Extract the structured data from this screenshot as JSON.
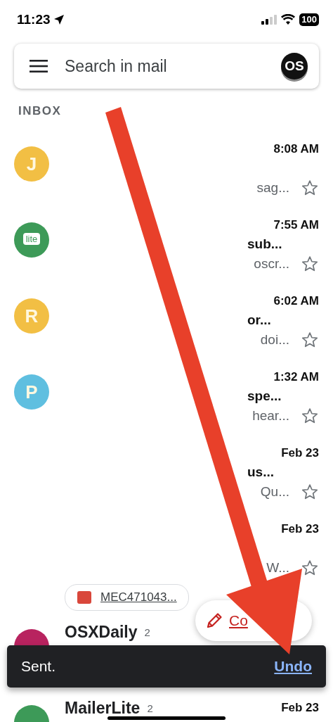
{
  "status_bar": {
    "time": "11:23",
    "battery": "100"
  },
  "search": {
    "placeholder": "Search in mail",
    "account_avatar": "OS"
  },
  "section_label": "INBOX",
  "rows": [
    {
      "avatar": {
        "kind": "letter",
        "text": "J",
        "color": "#f2bf44"
      },
      "time": "8:08 AM",
      "snippet": "sag...",
      "starred": false
    },
    {
      "avatar": {
        "kind": "logo",
        "text": "lite",
        "color": "#3d9a58"
      },
      "time": "7:55 AM",
      "subject": "sub...",
      "snippet": "oscr...",
      "starred": false
    },
    {
      "avatar": {
        "kind": "letter",
        "text": "R",
        "color": "#f2bf44"
      },
      "time": "6:02 AM",
      "subject": "or...",
      "snippet": "doi...",
      "starred": false
    },
    {
      "avatar": {
        "kind": "letter",
        "text": "P",
        "color": "#5fbfe0"
      },
      "time": "1:32 AM",
      "subject": "spe...",
      "snippet": "hear...",
      "starred": false
    },
    {
      "avatar": {
        "kind": "none"
      },
      "time": "Feb 23",
      "subject": "us...",
      "snippet": "Qu...",
      "starred": false
    },
    {
      "avatar": {
        "kind": "none"
      },
      "time": "Feb 23",
      "snippet": "W...",
      "starred": false,
      "attachment": "MEC471043..."
    },
    {
      "avatar": {
        "kind": "plain",
        "color": "#b8235f"
      },
      "sender": "OSXDaily",
      "count": "2"
    },
    {
      "avatar": {
        "kind": "plain",
        "color": "#3d9a58"
      },
      "sender": "MailerLite",
      "count": "2",
      "time": "Feb 23"
    }
  ],
  "compose": {
    "label": "Co"
  },
  "snackbar": {
    "message": "Sent.",
    "action": "Undo"
  }
}
